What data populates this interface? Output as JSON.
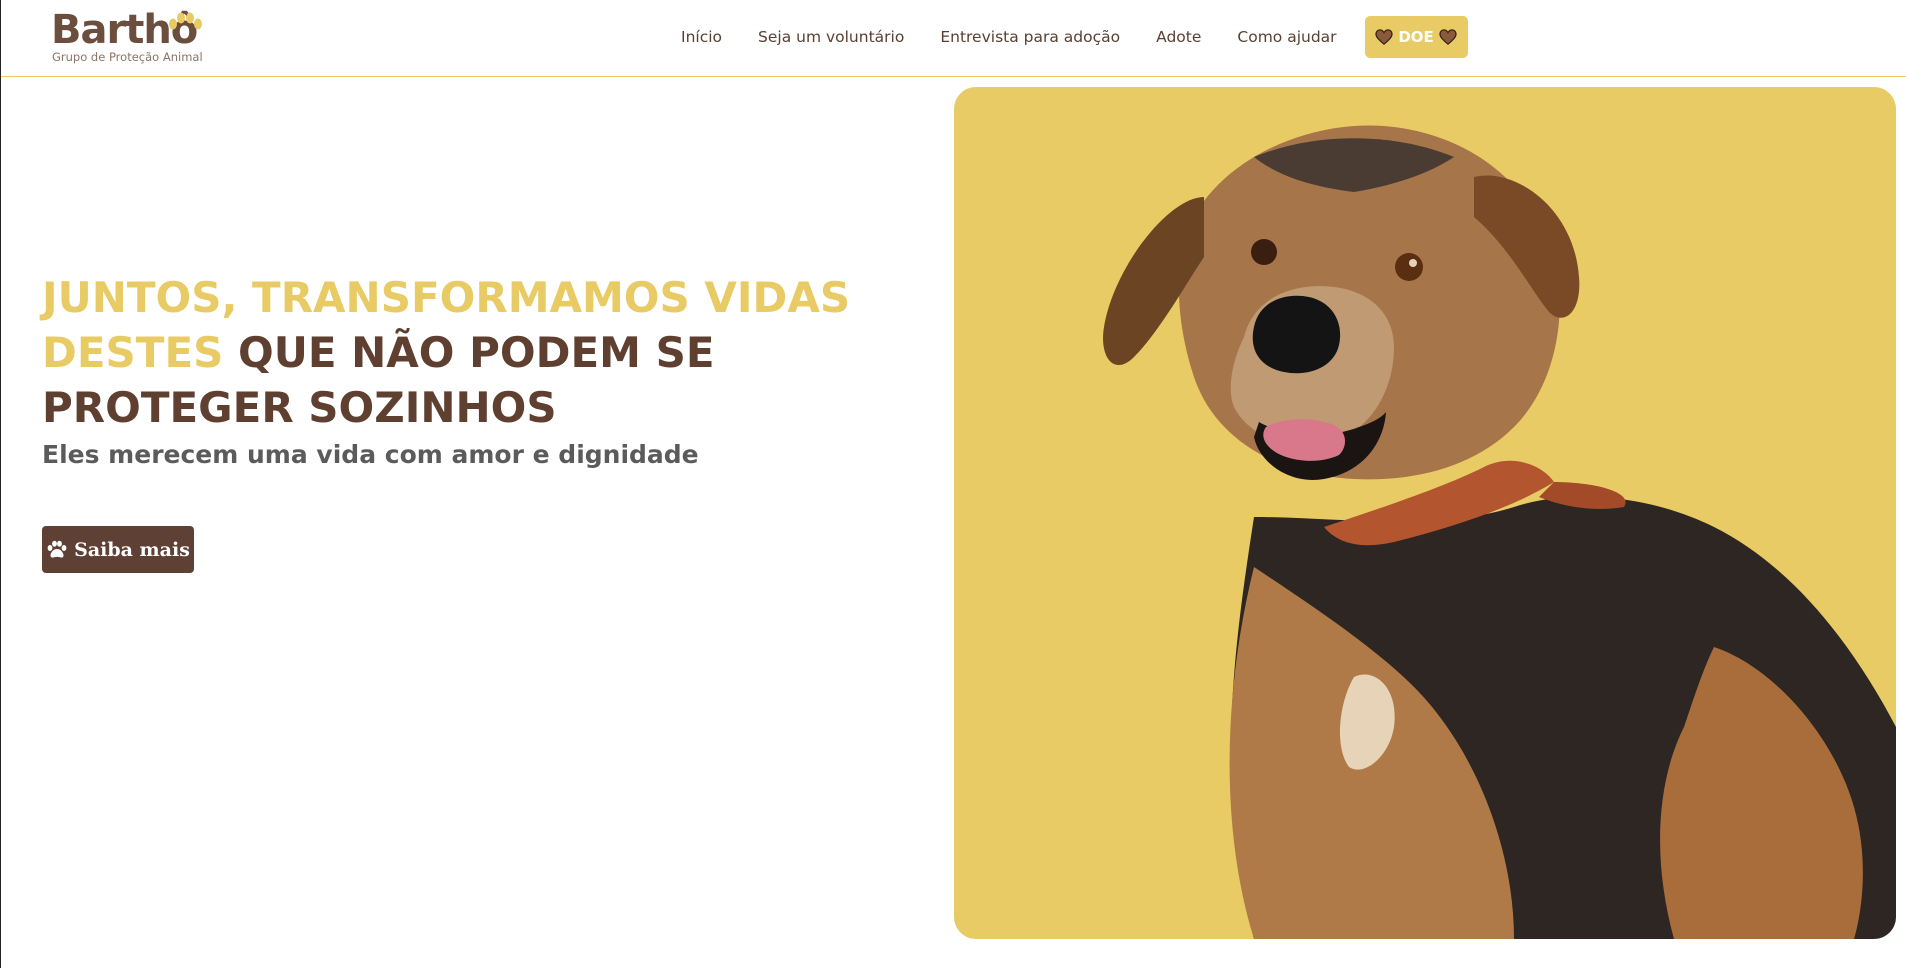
{
  "brand": {
    "name": "Barthô",
    "tagline": "Grupo de Proteção Animal"
  },
  "nav": {
    "items": [
      {
        "label": "Início"
      },
      {
        "label": "Seja um voluntário"
      },
      {
        "label": "Entrevista para adoção"
      },
      {
        "label": "Adote"
      },
      {
        "label": "Como ajudar"
      }
    ],
    "donate_label": "DOE"
  },
  "hero": {
    "headline_gold": "JUNTOS, TRANSFORMAMOS VIDAS DESTES",
    "headline_dark": "QUE NÃO PODEM SE PROTEGER SOZINHOS",
    "subheadline": "Eles merecem uma vida com amor e dignidade",
    "cta_label": "Saiba mais"
  },
  "colors": {
    "gold": "#e8cb64",
    "brown": "#5e3f30",
    "gray_text": "#5b5b5b"
  },
  "icons": {
    "logo": "paw-icon",
    "donate": "heart-icon",
    "cta": "paw-icon"
  }
}
